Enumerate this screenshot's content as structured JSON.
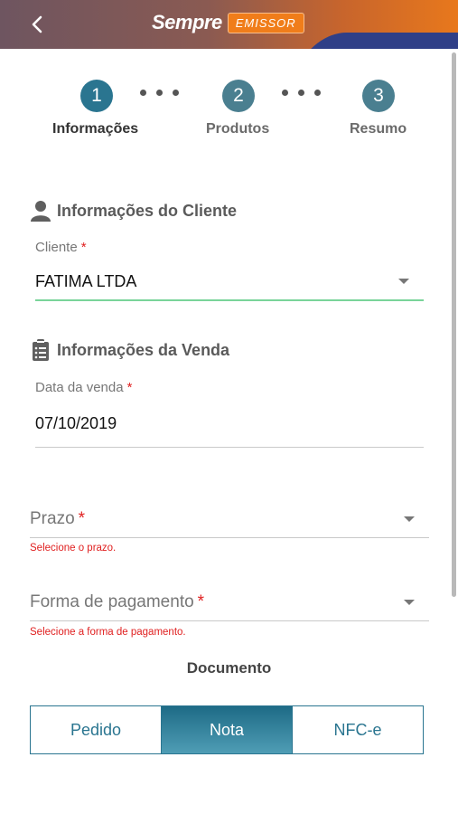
{
  "header": {
    "logo_text": "Sempre",
    "logo_badge": "EMISSOR",
    "back_icon": "chevron-left-icon",
    "colors": {
      "gradient_start": "#6e5560",
      "gradient_end": "#e8781c",
      "accent_navy": "#2f3f87"
    }
  },
  "stepper": {
    "steps": [
      {
        "number": "1",
        "label": "Informações",
        "active": true
      },
      {
        "number": "2",
        "label": "Produtos",
        "active": false
      },
      {
        "number": "3",
        "label": "Resumo",
        "active": false
      }
    ]
  },
  "client_section": {
    "title": "Informações do Cliente",
    "icon": "person-icon",
    "client_label": "Cliente",
    "required_mark": "*",
    "client_value": "FATIMA LTDA"
  },
  "sale_section": {
    "title": "Informações da Venda",
    "icon": "clipboard-icon",
    "date_label": "Data da venda",
    "required_mark": "*",
    "date_value": "07/10/2019",
    "prazo_placeholder": "Prazo",
    "prazo_error": "Selecione o prazo.",
    "payment_placeholder": "Forma de pagamento",
    "payment_error": "Selecione a forma de pagamento."
  },
  "document": {
    "title": "Documento",
    "options": [
      "Pedido",
      "Nota",
      "NFC-e"
    ],
    "selected": "Nota"
  },
  "colors": {
    "primary": "#2a7590",
    "error": "#e02020",
    "focus_underline": "#7ad49a"
  }
}
